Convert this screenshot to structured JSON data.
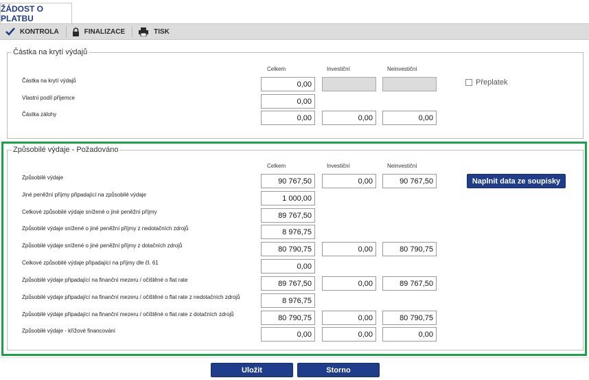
{
  "tab": {
    "label": "ŽÁDOST O PLATBU"
  },
  "toolbar": {
    "items": [
      {
        "label": "KONTROLA",
        "icon": "check-icon"
      },
      {
        "label": "FINALIZACE",
        "icon": "lock-icon"
      },
      {
        "label": "TISK",
        "icon": "printer-icon"
      }
    ]
  },
  "section1": {
    "legend": "Částka na krytí výdajů",
    "col_headers": [
      "Celkem",
      "Investiční",
      "Neinvestiční"
    ],
    "rows": [
      {
        "label": "Částka na krytí výdajů",
        "values": [
          "0,00",
          "",
          ""
        ]
      },
      {
        "label": "Vlastní podíl příjemce",
        "values": [
          "0,00"
        ]
      },
      {
        "label": "Částka zálohy",
        "values": [
          "0,00",
          "0,00",
          "0,00"
        ]
      }
    ],
    "checkbox_label": "Přeplatek"
  },
  "section2": {
    "legend": "Způsobilé výdaje - Požadováno",
    "col_headers": [
      "Celkem",
      "Investiční",
      "Neinvestiční"
    ],
    "fill_button": "Naplnit data ze soupisky",
    "rows": [
      {
        "label": "Způsobilé výdaje",
        "values": [
          "90 767,50",
          "0,00",
          "90 767,50"
        ]
      },
      {
        "label": "Jiné peněžní příjmy připadající na způsobilé výdaje",
        "values": [
          "1 000,00"
        ]
      },
      {
        "label": "Celkové způsobilé výdaje snížené o jiné peněžní příjmy",
        "values": [
          "89 767,50"
        ]
      },
      {
        "label": "Způsobilé výdaje snížené o jiné peněžní příjmy z nedotačních zdrojů",
        "values": [
          "8 976,75"
        ]
      },
      {
        "label": "Způsobilé výdaje snížené o jiné peněžní příjmy z dotačních zdrojů",
        "values": [
          "80 790,75",
          "0,00",
          "80 790,75"
        ]
      },
      {
        "label": "Celkové způsobilé výdaje připadající na příjmy dle čl. 61",
        "values": [
          "0,00"
        ]
      },
      {
        "label": "Způsobilé výdaje připadající na finanční mezeru / očištěné o flat rate",
        "values": [
          "89 767,50",
          "0,00",
          "89 767,50"
        ]
      },
      {
        "label": "Způsobilé výdaje připadající na finanční mezeru / očištěné o flat rate z nedotačních zdrojů",
        "values": [
          "8 976,75"
        ]
      },
      {
        "label": "Způsobilé výdaje připadající na finanční mezeru / očištěné o flat rate z dotačních zdrojů",
        "values": [
          "80 790,75",
          "0,00",
          "80 790,75"
        ]
      },
      {
        "label": "Způsobilé výdaje - křížové financování",
        "values": [
          "0,00",
          "0,00",
          "0,00"
        ]
      }
    ]
  },
  "footer": {
    "save_label": "Uložit",
    "cancel_label": "Storno"
  },
  "colors": {
    "accent": "#1f3d8a",
    "highlight_frame": "#1aa34a",
    "toolbar_bg": "#dcdcdc"
  }
}
